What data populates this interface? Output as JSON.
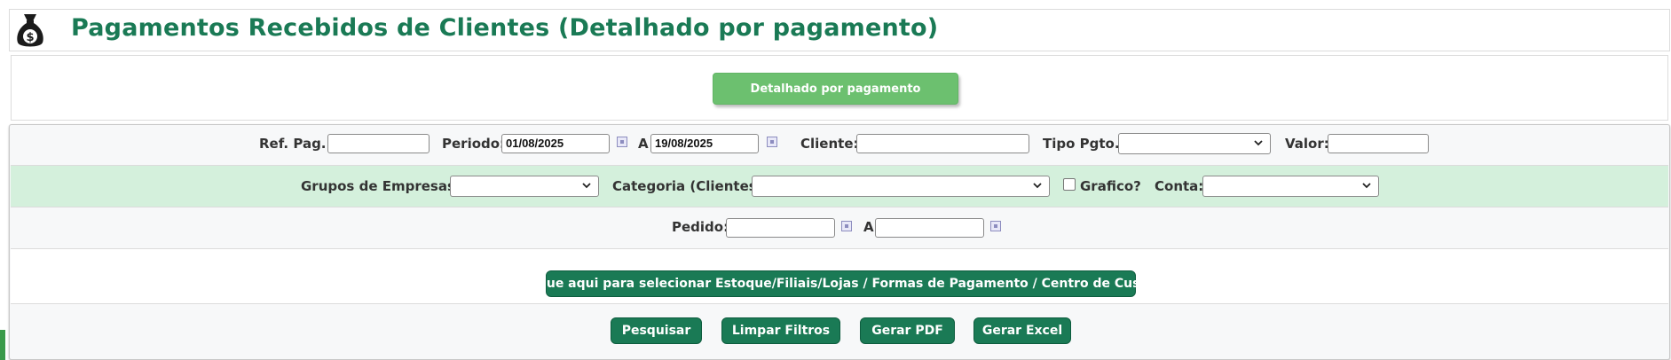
{
  "header": {
    "title": "Pagamentos Recebidos de Clientes (Detalhado por pagamento)",
    "icon": "money-bag-icon"
  },
  "tabs": {
    "active_label": "Detalhado por pagamento"
  },
  "filters": {
    "ref_pag_label": "Ref. Pag.:",
    "ref_pag_value": "",
    "periodo_label": "Periodo:",
    "periodo_start": "01/08/2025",
    "periodo_sep": "A",
    "periodo_end": "19/08/2025",
    "cliente_label": "Cliente:",
    "cliente_value": "",
    "tipo_pgto_label": "Tipo Pgto.:",
    "tipo_pgto_value": "",
    "valor_label": "Valor:",
    "valor_value": "",
    "grupos_label": "Grupos de Empresas:",
    "grupos_value": "",
    "categoria_label": "Categoria (Clientes):",
    "categoria_value": "",
    "grafico_label": "Grafico?",
    "grafico_checked": false,
    "conta_label": "Conta:",
    "conta_value": "",
    "pedido_label": "Pedido:",
    "pedido_start": "",
    "pedido_sep": "A",
    "pedido_end": ""
  },
  "actions": {
    "select_button": "Clique aqui para selecionar Estoque/Filiais/Lojas / Formas de Pagamento / Centro de Custos",
    "search_button": "Pesquisar",
    "clear_button": "Limpar Filtros",
    "pdf_button": "Gerar PDF",
    "excel_button": "Gerar Excel"
  },
  "colors": {
    "brand": "#1a7a55",
    "tab_green": "#6cc06f",
    "row_green": "#d4f0dc"
  }
}
